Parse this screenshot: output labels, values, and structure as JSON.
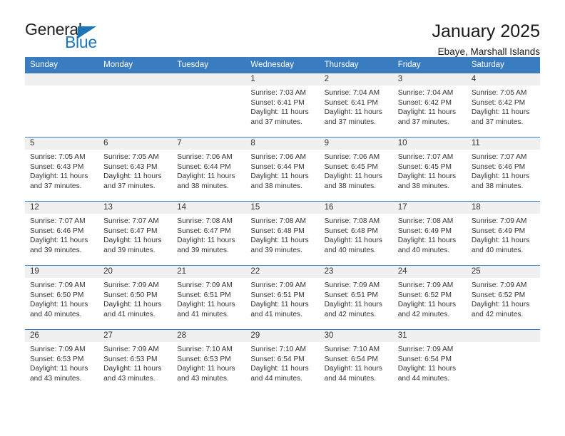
{
  "brand": {
    "name_part1": "General",
    "name_part2": "Blue",
    "triangle_icon": "triangle-icon",
    "accent_color": "#1b75bb"
  },
  "header": {
    "title": "January 2025",
    "subtitle": "Ebaye, Marshall Islands"
  },
  "theme": {
    "header_row_bg": "#3a7cc0",
    "daynum_bg": "#f0f0f0",
    "text_color": "#333333"
  },
  "weekday_headers": [
    "Sunday",
    "Monday",
    "Tuesday",
    "Wednesday",
    "Thursday",
    "Friday",
    "Saturday"
  ],
  "weeks": [
    [
      {
        "day": "",
        "blank": true,
        "sunrise": "",
        "sunset": "",
        "daylight1": "",
        "daylight2": ""
      },
      {
        "day": "",
        "blank": true,
        "sunrise": "",
        "sunset": "",
        "daylight1": "",
        "daylight2": ""
      },
      {
        "day": "",
        "blank": true,
        "sunrise": "",
        "sunset": "",
        "daylight1": "",
        "daylight2": ""
      },
      {
        "day": "1",
        "blank": false,
        "sunrise": "Sunrise: 7:03 AM",
        "sunset": "Sunset: 6:41 PM",
        "daylight1": "Daylight: 11 hours",
        "daylight2": "and 37 minutes."
      },
      {
        "day": "2",
        "blank": false,
        "sunrise": "Sunrise: 7:04 AM",
        "sunset": "Sunset: 6:41 PM",
        "daylight1": "Daylight: 11 hours",
        "daylight2": "and 37 minutes."
      },
      {
        "day": "3",
        "blank": false,
        "sunrise": "Sunrise: 7:04 AM",
        "sunset": "Sunset: 6:42 PM",
        "daylight1": "Daylight: 11 hours",
        "daylight2": "and 37 minutes."
      },
      {
        "day": "4",
        "blank": false,
        "sunrise": "Sunrise: 7:05 AM",
        "sunset": "Sunset: 6:42 PM",
        "daylight1": "Daylight: 11 hours",
        "daylight2": "and 37 minutes."
      }
    ],
    [
      {
        "day": "5",
        "blank": false,
        "sunrise": "Sunrise: 7:05 AM",
        "sunset": "Sunset: 6:43 PM",
        "daylight1": "Daylight: 11 hours",
        "daylight2": "and 37 minutes."
      },
      {
        "day": "6",
        "blank": false,
        "sunrise": "Sunrise: 7:05 AM",
        "sunset": "Sunset: 6:43 PM",
        "daylight1": "Daylight: 11 hours",
        "daylight2": "and 37 minutes."
      },
      {
        "day": "7",
        "blank": false,
        "sunrise": "Sunrise: 7:06 AM",
        "sunset": "Sunset: 6:44 PM",
        "daylight1": "Daylight: 11 hours",
        "daylight2": "and 38 minutes."
      },
      {
        "day": "8",
        "blank": false,
        "sunrise": "Sunrise: 7:06 AM",
        "sunset": "Sunset: 6:44 PM",
        "daylight1": "Daylight: 11 hours",
        "daylight2": "and 38 minutes."
      },
      {
        "day": "9",
        "blank": false,
        "sunrise": "Sunrise: 7:06 AM",
        "sunset": "Sunset: 6:45 PM",
        "daylight1": "Daylight: 11 hours",
        "daylight2": "and 38 minutes."
      },
      {
        "day": "10",
        "blank": false,
        "sunrise": "Sunrise: 7:07 AM",
        "sunset": "Sunset: 6:45 PM",
        "daylight1": "Daylight: 11 hours",
        "daylight2": "and 38 minutes."
      },
      {
        "day": "11",
        "blank": false,
        "sunrise": "Sunrise: 7:07 AM",
        "sunset": "Sunset: 6:46 PM",
        "daylight1": "Daylight: 11 hours",
        "daylight2": "and 38 minutes."
      }
    ],
    [
      {
        "day": "12",
        "blank": false,
        "sunrise": "Sunrise: 7:07 AM",
        "sunset": "Sunset: 6:46 PM",
        "daylight1": "Daylight: 11 hours",
        "daylight2": "and 39 minutes."
      },
      {
        "day": "13",
        "blank": false,
        "sunrise": "Sunrise: 7:07 AM",
        "sunset": "Sunset: 6:47 PM",
        "daylight1": "Daylight: 11 hours",
        "daylight2": "and 39 minutes."
      },
      {
        "day": "14",
        "blank": false,
        "sunrise": "Sunrise: 7:08 AM",
        "sunset": "Sunset: 6:47 PM",
        "daylight1": "Daylight: 11 hours",
        "daylight2": "and 39 minutes."
      },
      {
        "day": "15",
        "blank": false,
        "sunrise": "Sunrise: 7:08 AM",
        "sunset": "Sunset: 6:48 PM",
        "daylight1": "Daylight: 11 hours",
        "daylight2": "and 39 minutes."
      },
      {
        "day": "16",
        "blank": false,
        "sunrise": "Sunrise: 7:08 AM",
        "sunset": "Sunset: 6:48 PM",
        "daylight1": "Daylight: 11 hours",
        "daylight2": "and 40 minutes."
      },
      {
        "day": "17",
        "blank": false,
        "sunrise": "Sunrise: 7:08 AM",
        "sunset": "Sunset: 6:49 PM",
        "daylight1": "Daylight: 11 hours",
        "daylight2": "and 40 minutes."
      },
      {
        "day": "18",
        "blank": false,
        "sunrise": "Sunrise: 7:09 AM",
        "sunset": "Sunset: 6:49 PM",
        "daylight1": "Daylight: 11 hours",
        "daylight2": "and 40 minutes."
      }
    ],
    [
      {
        "day": "19",
        "blank": false,
        "sunrise": "Sunrise: 7:09 AM",
        "sunset": "Sunset: 6:50 PM",
        "daylight1": "Daylight: 11 hours",
        "daylight2": "and 40 minutes."
      },
      {
        "day": "20",
        "blank": false,
        "sunrise": "Sunrise: 7:09 AM",
        "sunset": "Sunset: 6:50 PM",
        "daylight1": "Daylight: 11 hours",
        "daylight2": "and 41 minutes."
      },
      {
        "day": "21",
        "blank": false,
        "sunrise": "Sunrise: 7:09 AM",
        "sunset": "Sunset: 6:51 PM",
        "daylight1": "Daylight: 11 hours",
        "daylight2": "and 41 minutes."
      },
      {
        "day": "22",
        "blank": false,
        "sunrise": "Sunrise: 7:09 AM",
        "sunset": "Sunset: 6:51 PM",
        "daylight1": "Daylight: 11 hours",
        "daylight2": "and 41 minutes."
      },
      {
        "day": "23",
        "blank": false,
        "sunrise": "Sunrise: 7:09 AM",
        "sunset": "Sunset: 6:51 PM",
        "daylight1": "Daylight: 11 hours",
        "daylight2": "and 42 minutes."
      },
      {
        "day": "24",
        "blank": false,
        "sunrise": "Sunrise: 7:09 AM",
        "sunset": "Sunset: 6:52 PM",
        "daylight1": "Daylight: 11 hours",
        "daylight2": "and 42 minutes."
      },
      {
        "day": "25",
        "blank": false,
        "sunrise": "Sunrise: 7:09 AM",
        "sunset": "Sunset: 6:52 PM",
        "daylight1": "Daylight: 11 hours",
        "daylight2": "and 42 minutes."
      }
    ],
    [
      {
        "day": "26",
        "blank": false,
        "sunrise": "Sunrise: 7:09 AM",
        "sunset": "Sunset: 6:53 PM",
        "daylight1": "Daylight: 11 hours",
        "daylight2": "and 43 minutes."
      },
      {
        "day": "27",
        "blank": false,
        "sunrise": "Sunrise: 7:09 AM",
        "sunset": "Sunset: 6:53 PM",
        "daylight1": "Daylight: 11 hours",
        "daylight2": "and 43 minutes."
      },
      {
        "day": "28",
        "blank": false,
        "sunrise": "Sunrise: 7:10 AM",
        "sunset": "Sunset: 6:53 PM",
        "daylight1": "Daylight: 11 hours",
        "daylight2": "and 43 minutes."
      },
      {
        "day": "29",
        "blank": false,
        "sunrise": "Sunrise: 7:10 AM",
        "sunset": "Sunset: 6:54 PM",
        "daylight1": "Daylight: 11 hours",
        "daylight2": "and 44 minutes."
      },
      {
        "day": "30",
        "blank": false,
        "sunrise": "Sunrise: 7:10 AM",
        "sunset": "Sunset: 6:54 PM",
        "daylight1": "Daylight: 11 hours",
        "daylight2": "and 44 minutes."
      },
      {
        "day": "31",
        "blank": false,
        "sunrise": "Sunrise: 7:09 AM",
        "sunset": "Sunset: 6:54 PM",
        "daylight1": "Daylight: 11 hours",
        "daylight2": "and 44 minutes."
      },
      {
        "day": "",
        "blank": true,
        "sunrise": "",
        "sunset": "",
        "daylight1": "",
        "daylight2": ""
      }
    ]
  ]
}
